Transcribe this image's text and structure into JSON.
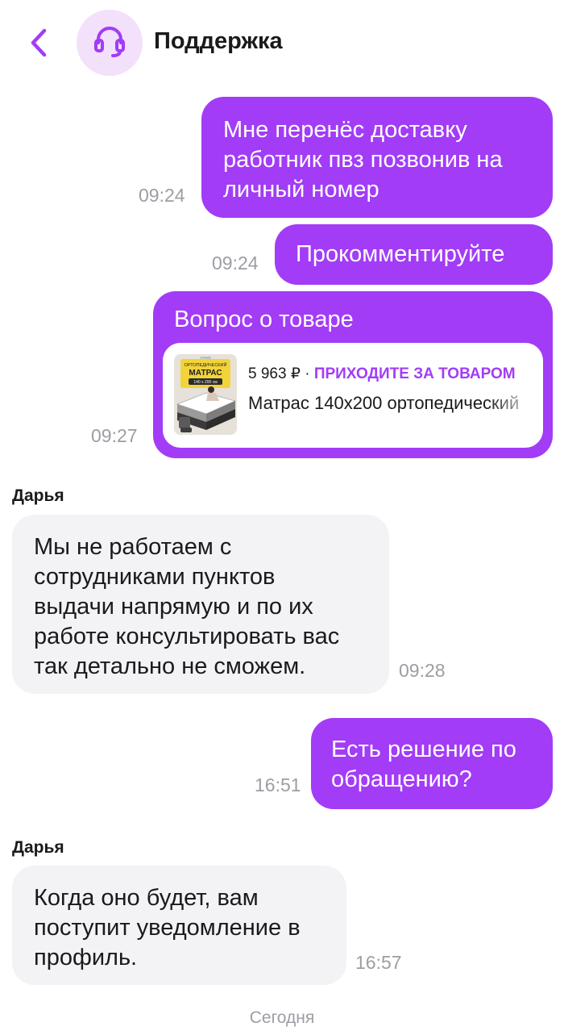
{
  "header": {
    "title": "Поддержка"
  },
  "messages": {
    "m1": {
      "text_lines": [
        "Мне перенёс доставку",
        "работник пвз позвонив на",
        "личный номер"
      ],
      "time": "09:24"
    },
    "m2": {
      "text": "Прокомментируйте",
      "time": "09:24"
    },
    "m3": {
      "title": "Вопрос о товаре",
      "time": "09:27",
      "product": {
        "price": "5 963 ₽",
        "separator": "·",
        "status": "ПРИХОДИТЕ ЗА ТОВАРОМ",
        "name": "Матрас 140х200 ортопедический",
        "image_brand": "ormado",
        "image_line1": "ОРТОПЕДИЧЕСКИЙ",
        "image_line2": "МАТРАС",
        "image_size": "140 x 200 см"
      }
    },
    "m4": {
      "sender": "Дарья",
      "text_lines": [
        "Мы не работаем с",
        "сотрудниками пунктов",
        "выдачи напрямую и по их",
        "работе консультировать вас",
        "так детально не сможем."
      ],
      "time": "09:28"
    },
    "m5": {
      "text_lines": [
        "Есть решение по",
        "обращению?"
      ],
      "time": "16:51"
    },
    "m6": {
      "sender": "Дарья",
      "text_lines": [
        "Когда оно будет, вам",
        "поступит уведомление в",
        "профиль."
      ],
      "time": "16:57"
    }
  },
  "date_separator": "Сегодня",
  "colors": {
    "accent": "#a23cf7",
    "incoming_bubble": "#f3f3f6",
    "avatar_bg": "#f3e0fb",
    "muted_text": "#9d9da4"
  },
  "icons": {
    "back": "chevron-left-icon",
    "avatar": "headset-icon"
  }
}
